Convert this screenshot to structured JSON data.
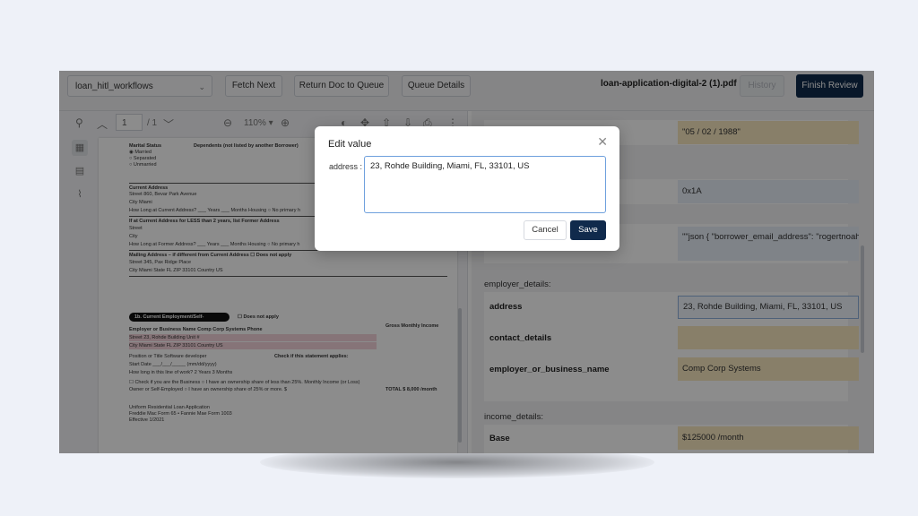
{
  "toolbar": {
    "workflow_select": "loan_hitl_workflows",
    "fetch_next": "Fetch Next",
    "return_doc": "Return Doc to Queue",
    "queue_details": "Queue Details",
    "filename": "loan-application-digital-2 (1).pdf",
    "history": "History",
    "finish_review": "Finish Review"
  },
  "viewer": {
    "page_input": "1",
    "page_total": "/ 1",
    "zoom": "110% ▾",
    "doc_lines": {
      "marital": "Marital Status",
      "dependents": "Dependents (not listed by another Borrower)",
      "married": "◉ Married",
      "separated": "○ Separated",
      "unmarried": "○ Unmarried",
      "current_address": "Current Address",
      "street1": "Street  860, Bevar Park Avenue",
      "city1": "City  Miami",
      "how_long1": "How Long at Current Address? ___ Years ___ Months   Housing  ○ No primary h",
      "former": "If at Current Address for LESS than 2 years, list Former Address",
      "street2": "Street",
      "city2": "City",
      "how_long2": "How Long at Former Address? ___ Years ___ Months   Housing  ○ No primary h",
      "mailing": "Mailing Address – if different from Current Address   ☐ Does not apply",
      "street3": "Street  345, Pax Ridge Place",
      "city3": "City  Miami                                                     State  FL     ZIP  33101      Country  US",
      "section": "1b. Current Employment/Self-Employment and Income",
      "does_not_apply": "☐ Does not apply",
      "employer": "Employer or Business Name  Comp Corp Systems                    Phone",
      "gross": "Gross Monthly Income",
      "street4": "Street  23, Rohde Building                                                       Unit #",
      "city4": "City  Miami                                       State  FL      ZIP  33101       Country  US",
      "position": "Position or Title  Software developer",
      "check_if": "Check if this statement applies:",
      "start_date": "Start Date  ___/___/_____  (mm/dd/yyyy)",
      "how_long_line": "How long in this line of work?  2  Years   3  Months",
      "check_business": "☐ Check if you are the Business   ○ I have an ownership share of less than 25%.   Monthly Income (or Loss)",
      "owner": "   Owner or Self-Employed          ○ I have an ownership share of 25% or more.   $",
      "total": "TOTAL $          8,000 /month",
      "footer1": "Uniform Residential Loan Application",
      "footer2": "Freddie Mac Form 65 • Fannie Mae Form 1003",
      "footer3": "Effective 1/2021"
    }
  },
  "fields": {
    "dob_value": "\"05 / 02 / 1988\"",
    "hex_value": "0x1A",
    "json_value": "\"\"json { \"borrower_email_address\": \"rogertnoah@compcorp.com\" } \"\"",
    "employer_group": "employer_details:",
    "address_label": "address",
    "address_value": "23, Rohde Building, Miami, FL, 33101, US",
    "contact_label": "contact_details",
    "contact_value": "",
    "employer_name_label": "employer_or_business_name",
    "employer_name_value": "Comp Corp Systems",
    "income_group": "income_details:",
    "base_label": "Base",
    "base_value": "$125000 /month"
  },
  "modal": {
    "title": "Edit value",
    "label": "address :",
    "value": "23, Rohde Building, Miami, FL, 33101, US",
    "cancel": "Cancel",
    "save": "Save"
  },
  "colors": {
    "primary": "#102a4c",
    "value_highlight": "#f7e7c0",
    "selection_highlight": "#f5d3da"
  }
}
